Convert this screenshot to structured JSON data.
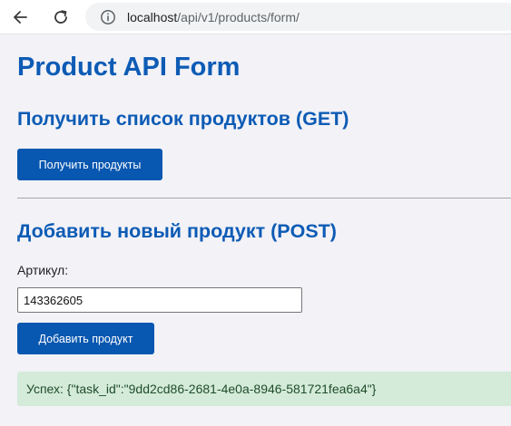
{
  "browser": {
    "url_host": "localhost",
    "url_path": "/api/v1/products/form/"
  },
  "page": {
    "title": "Product API Form",
    "get_section": {
      "heading": "Получить список продуктов (GET)",
      "button_label": "Получить продукты"
    },
    "post_section": {
      "heading": "Добавить новый продукт (POST)",
      "field_label": "Артикул:",
      "field_value": "143362605",
      "button_label": "Добавить продукт"
    },
    "result_text": "Успех: {\"task_id\":\"9dd2cd86-2681-4e0a-8946-581721fea6a4\"}"
  },
  "colors": {
    "accent": "#0d5bb5",
    "button": "#0857b0",
    "success_bg": "#d4ebd9",
    "page_bg": "#f2f2f7"
  }
}
